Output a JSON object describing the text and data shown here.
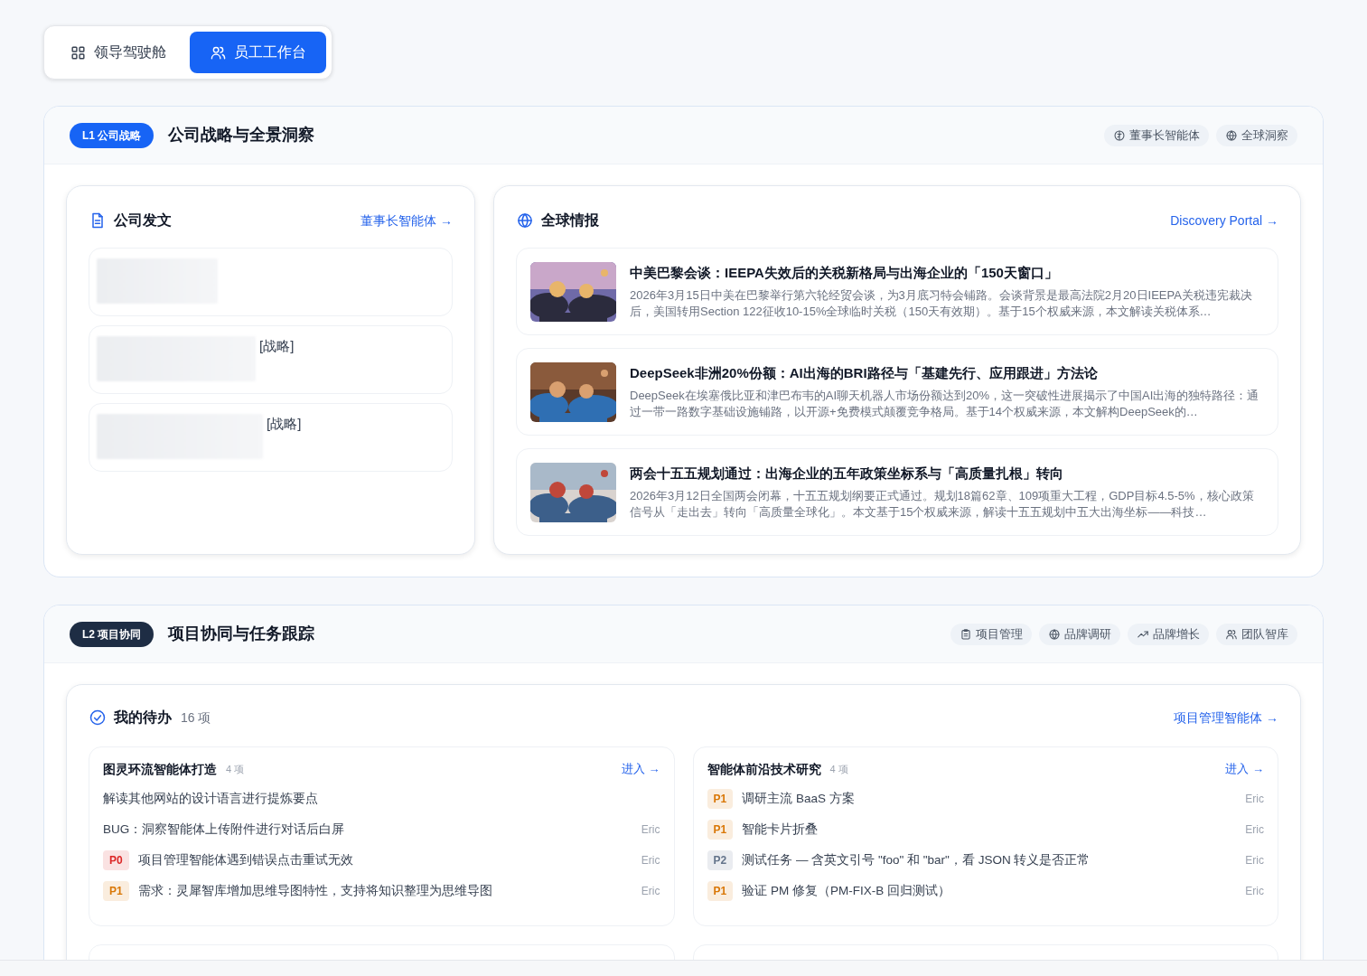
{
  "view_switch": [
    {
      "label": "领导驾驶舱",
      "kind": "grid",
      "selected": false
    },
    {
      "label": "员工工作台",
      "kind": "users",
      "selected": true
    }
  ],
  "sections": [
    {
      "badge": "L1 公司战略",
      "title": "公司战略与全景洞察",
      "chips": [
        {
          "label": "董事长智能体",
          "kind": "brain"
        },
        {
          "label": "全球洞察",
          "kind": "globe"
        }
      ]
    },
    {
      "badge": "L2 项目协同",
      "title": "项目协同与任务跟踪",
      "chips": [
        {
          "label": "项目管理",
          "kind": "clipboard"
        },
        {
          "label": "品牌调研",
          "kind": "globe"
        },
        {
          "label": "品牌增长",
          "kind": "trend"
        },
        {
          "label": "团队智库",
          "kind": "users"
        }
      ]
    }
  ],
  "documents": {
    "title": "公司发文",
    "link": "董事长智能体 →",
    "items": [
      {
        "kind": "blurred"
      },
      {
        "kind": "blurred",
        "tag": "[战略]"
      },
      {
        "kind": "blurred",
        "tag": "[战略]"
      }
    ]
  },
  "news": {
    "title": "全球情报",
    "link": "Discovery Portal →",
    "items": [
      {
        "kind": "picture",
        "title": "中美巴黎会谈：IEEPA失效后的关税新格局与出海企业的「150天窗口」",
        "summary": "2026年3月15日中美在巴黎举行第六轮经贸会谈，为3月底习特会铺路。会谈背景是最高法院2月20日IEEPA关税违宪裁决后，美国转用Section 122征收10-15%全球临时关税（150天有效期）。基于15个权威来源，本文解读关税体系…"
      },
      {
        "kind": "picture",
        "title": "DeepSeek非洲20%份额：AI出海的BRI路径与「基建先行、应用跟进」方法论",
        "summary": "DeepSeek在埃塞俄比亚和津巴布韦的AI聊天机器人市场份额达到20%，这一突破性进展揭示了中国AI出海的独特路径：通过一带一路数字基础设施铺路，以开源+免费模式颠覆竞争格局。基于14个权威来源，本文解构DeepSeek的…"
      },
      {
        "kind": "picture",
        "title": "两会十五五规划通过：出海企业的五年政策坐标系与「高质量扎根」转向",
        "summary": "2026年3月12日全国两会闭幕，十五五规划纲要正式通过。规划18篇62章、109项重大工程，GDP目标4.5-5%，核心政策信号从「走出去」转向「高质量全球化」。本文基于15个权威来源，解读十五五规划中五大出海坐标——科技…"
      }
    ]
  },
  "todos": {
    "title": "我的待办",
    "count": "16 项",
    "link": "项目管理智能体 →",
    "groups": [
      {
        "name": "图灵环流智能体打造",
        "count": "4 项",
        "link": "进入 →",
        "items": [
          {
            "text": "解读其他网站的设计语言进行提炼要点"
          },
          {
            "text": "BUG：洞察智能体上传附件进行对话后白屏",
            "assignee": "Eric"
          },
          {
            "priority": {
              "label": "P0",
              "color": "#dc2626"
            },
            "text": "项目管理智能体遇到错误点击重试无效",
            "assignee": "Eric"
          },
          {
            "priority": {
              "label": "P1",
              "color": "#d97706"
            },
            "text": "需求：灵犀智库增加思维导图特性，支持将知识整理为思维导图",
            "assignee": "Eric"
          }
        ]
      },
      {
        "name": "智能体前沿技术研究",
        "count": "4 项",
        "link": "进入 →",
        "items": [
          {
            "priority": {
              "label": "P1",
              "color": "#d97706"
            },
            "text": "调研主流 BaaS 方案",
            "assignee": "Eric"
          },
          {
            "priority": {
              "label": "P1",
              "color": "#d97706"
            },
            "text": "智能卡片折叠",
            "assignee": "Eric"
          },
          {
            "priority": {
              "label": "P2",
              "color": "#64748b"
            },
            "text": "测试任务 — 含英文引号 \"foo\" 和 \"bar\"，看 JSON 转义是否正常",
            "assignee": "Eric"
          },
          {
            "priority": {
              "label": "P1",
              "color": "#d97706"
            },
            "text": "验证 PM 修复（PM-FIX-B 回归测试）",
            "assignee": "Eric"
          }
        ]
      }
    ]
  }
}
